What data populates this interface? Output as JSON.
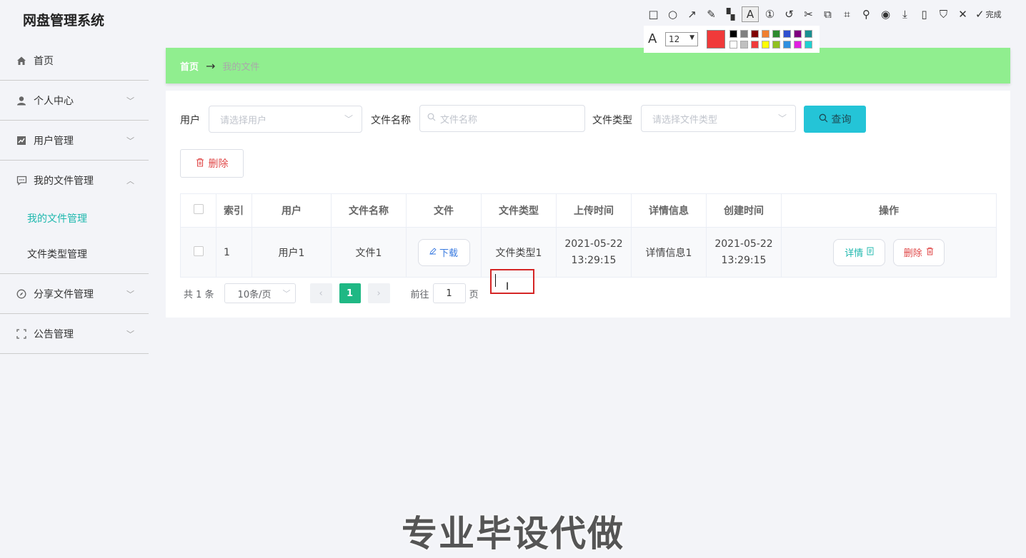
{
  "app": {
    "title": "网盘管理系统"
  },
  "sidebar": {
    "items": [
      {
        "label": "首页"
      },
      {
        "label": "个人中心"
      },
      {
        "label": "用户管理"
      },
      {
        "label": "我的文件管理"
      },
      {
        "label": "分享文件管理"
      },
      {
        "label": "公告管理"
      }
    ],
    "subitems": [
      {
        "label": "我的文件管理",
        "active": true
      },
      {
        "label": "文件类型管理"
      }
    ]
  },
  "breadcrumb": {
    "home": "首页",
    "arrow": "→",
    "current": "我的文件"
  },
  "filters": {
    "user_label": "用户",
    "user_placeholder": "请选择用户",
    "filename_label": "文件名称",
    "filename_placeholder": "文件名称",
    "filetype_label": "文件类型",
    "filetype_placeholder": "请选择文件类型",
    "query_label": "查询"
  },
  "actions": {
    "delete_label": "删除"
  },
  "table": {
    "headers": [
      "索引",
      "用户",
      "文件名称",
      "文件",
      "文件类型",
      "上传时间",
      "详情信息",
      "创建时间",
      "操作"
    ],
    "rows": [
      {
        "index": "1",
        "user": "用户1",
        "filename": "文件1",
        "download": "下载",
        "filetype": "文件类型1",
        "upload_date": "2021-05-22",
        "upload_time": "13:29:15",
        "detail": "详情信息1",
        "create_date": "2021-05-22",
        "create_time": "13:29:15",
        "detail_btn": "详情",
        "delete_btn": "删除"
      }
    ]
  },
  "pagination": {
    "total": "共 1 条",
    "page_size": "10条/页",
    "current": "1",
    "goto": "前往",
    "goto_value": "1",
    "page_unit": "页"
  },
  "annot_toolbar": {
    "done": "完成",
    "font_size": "12",
    "current_color": "#f03a3a",
    "palette": [
      "#000000",
      "#808080",
      "#800000",
      "#f08030",
      "#2e8b2e",
      "#3050d0",
      "#800080",
      "#1a9090",
      "#ffffff",
      "#c0c0c0",
      "#f03a3a",
      "#ffff00",
      "#90c020",
      "#3090e0",
      "#e020e0",
      "#20d0d0"
    ]
  },
  "watermark": "专业毕设代做",
  "colors": {
    "accent": "#1fb8ae",
    "breadcrumb_bg": "#90ee8f",
    "query_btn": "#24c4d7",
    "danger": "#e04949"
  }
}
